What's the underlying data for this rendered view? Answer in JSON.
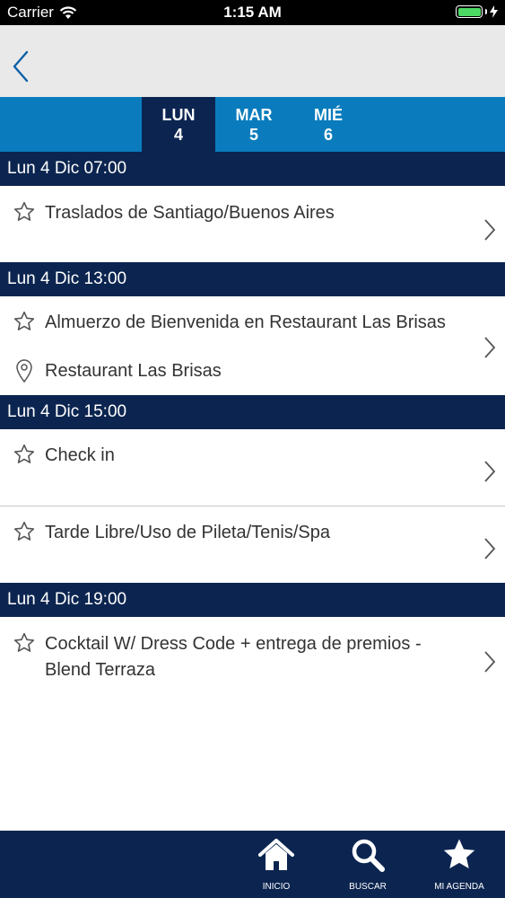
{
  "status_bar": {
    "carrier": "Carrier",
    "time": "1:15 AM",
    "battery_color": "#4cd964"
  },
  "nav": {
    "back_icon": "chevron-left-icon"
  },
  "day_tabs": [
    {
      "day": "LUN",
      "date": "4",
      "active": true
    },
    {
      "day": "MAR",
      "date": "5",
      "active": false
    },
    {
      "day": "MIÉ",
      "date": "6",
      "active": false
    }
  ],
  "sections": [
    {
      "header": "Lun 4 Dic 07:00",
      "events": [
        {
          "title": "Traslados de Santiago/Buenos Aires"
        }
      ]
    },
    {
      "header": "Lun 4 Dic 13:00",
      "events": [
        {
          "title": "Almuerzo de Bienvenida en Restaurant Las Brisas",
          "location": "Restaurant Las Brisas"
        }
      ]
    },
    {
      "header": "Lun 4 Dic 15:00",
      "events": [
        {
          "title": "Check in"
        },
        {
          "title": "Tarde Libre/Uso de Pileta/Tenis/Spa"
        }
      ]
    },
    {
      "header": "Lun 4 Dic 19:00",
      "events": [
        {
          "title_line1": "Cocktail W/ Dress Code + entrega de premios -",
          "title_line2": "Blend Terraza"
        }
      ]
    }
  ],
  "tab_bar": [
    {
      "label": "INICIO",
      "icon": "home-icon"
    },
    {
      "label": "BUSCAR",
      "icon": "search-icon"
    },
    {
      "label": "MI AGENDA",
      "icon": "star-icon"
    }
  ],
  "colors": {
    "navy": "#0c2550",
    "blue": "#0a7cbd",
    "nav_gray": "#e9e9e9",
    "icon_gray": "#555555"
  }
}
